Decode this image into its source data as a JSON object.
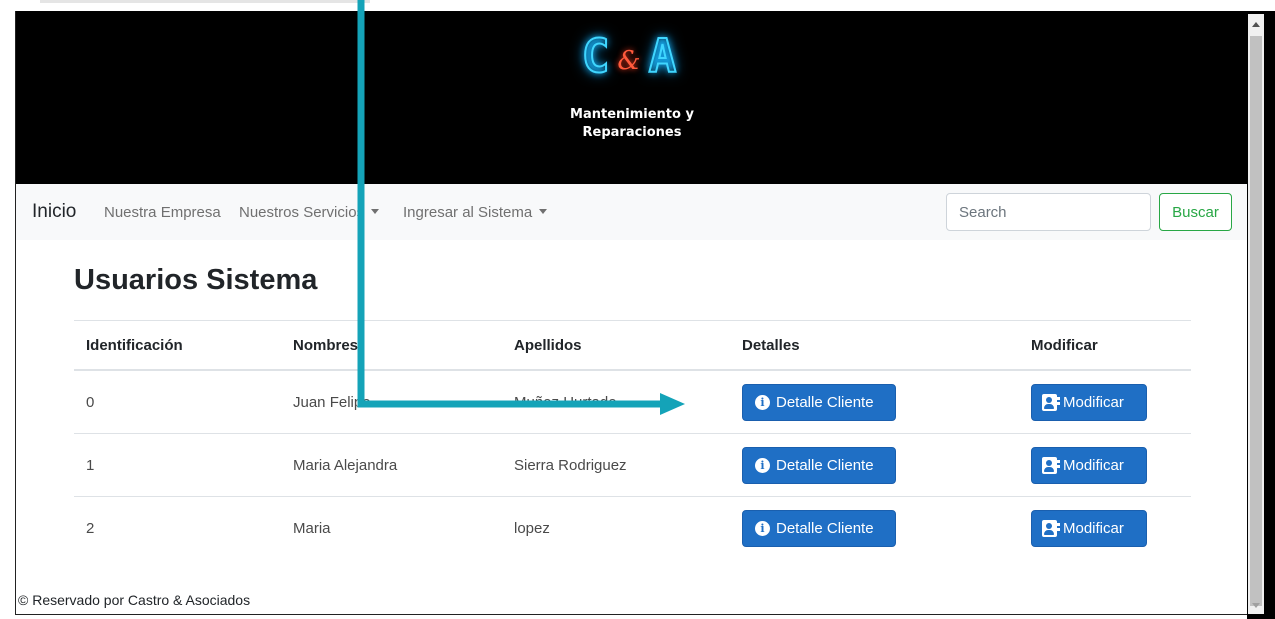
{
  "header": {
    "logo_left": "C",
    "logo_amp": "&",
    "logo_right": "A",
    "tagline_line1": "Mantenimiento y",
    "tagline_line2": "Reparaciones"
  },
  "navbar": {
    "brand": "Inicio",
    "items": [
      {
        "label": "Nuestra Empresa",
        "dropdown": false
      },
      {
        "label": "Nuestros Servicios",
        "dropdown": true
      },
      {
        "label": "Ingresar al Sistema",
        "dropdown": true
      }
    ],
    "search_placeholder": "Search",
    "search_button": "Buscar"
  },
  "main": {
    "title": "Usuarios Sistema",
    "columns": [
      "Identificación",
      "Nombres",
      "Apellidos",
      "Detalles",
      "Modificar"
    ],
    "rows": [
      {
        "id": "0",
        "nombres": "Juan Felipe",
        "apellidos": "Muñoz Hurtado",
        "detail_label": "Detalle Cliente",
        "modify_label": "Modificar"
      },
      {
        "id": "1",
        "nombres": "Maria Alejandra",
        "apellidos": "Sierra Rodriguez",
        "detail_label": "Detalle Cliente",
        "modify_label": "Modificar"
      },
      {
        "id": "2",
        "nombres": "Maria",
        "apellidos": "lopez",
        "detail_label": "Detalle Cliente",
        "modify_label": "Modificar"
      }
    ]
  },
  "footer": {
    "text": "© Reservado por Castro & Asociados"
  },
  "colors": {
    "primary": "#1f6fc5",
    "success": "#28a745",
    "annotation": "#14a3b8",
    "logo_neon": "#3fd6ff",
    "logo_amp": "#ff5a3c"
  },
  "icons": {
    "detail": "info-circle-icon",
    "modify": "user-card-icon"
  }
}
